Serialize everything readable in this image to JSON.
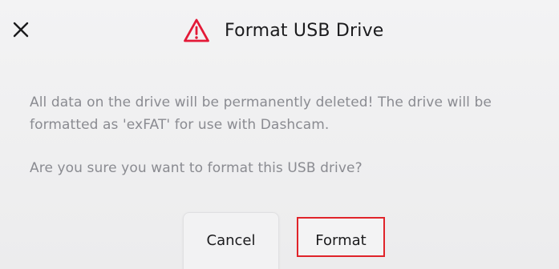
{
  "dialog": {
    "title": "Format USB Drive",
    "close_icon": "close-icon",
    "warning_icon": "warning-triangle-icon",
    "warning_color": "#e31937",
    "message": "All data on the drive will be permanently deleted! The drive will be formatted as 'exFAT' for use with Dashcam.",
    "question": "Are you sure you want to format this USB drive?",
    "cancel_label": "Cancel",
    "format_label": "Format"
  }
}
